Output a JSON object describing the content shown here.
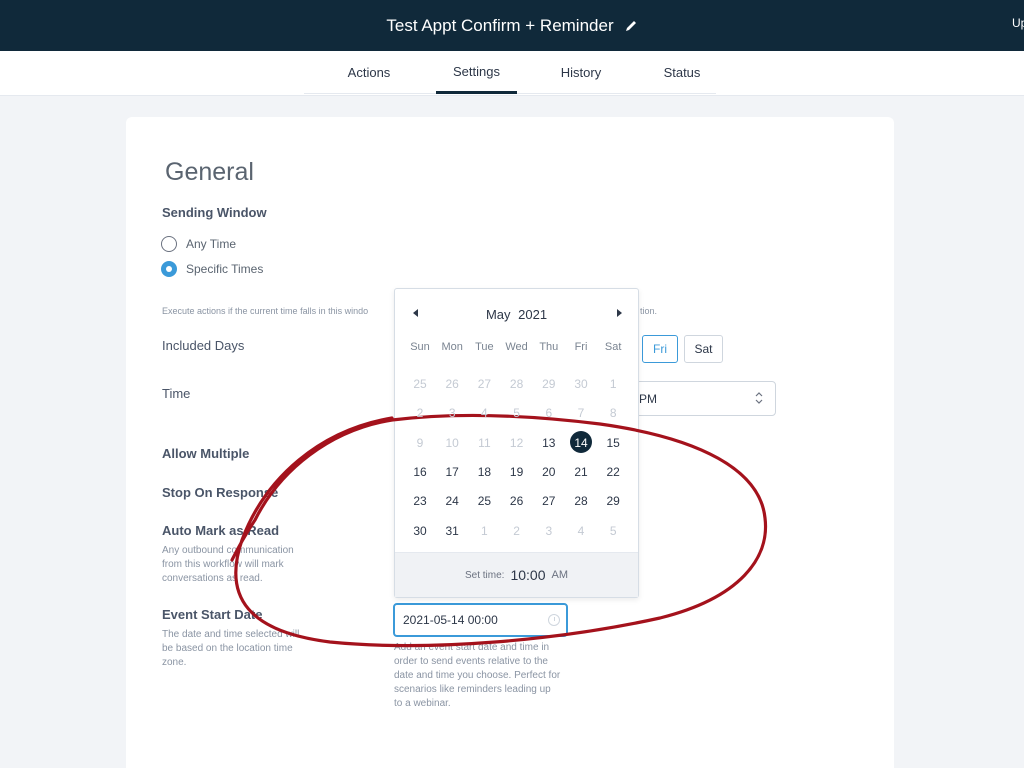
{
  "header": {
    "title": "Test Appt Confirm + Reminder",
    "right_text": "Up"
  },
  "tabs": [
    {
      "label": "Actions",
      "active": false
    },
    {
      "label": "Settings",
      "active": true
    },
    {
      "label": "History",
      "active": false
    },
    {
      "label": "Status",
      "active": false
    }
  ],
  "general": {
    "heading": "General",
    "sending_window": {
      "label": "Sending Window",
      "options": [
        {
          "label": "Any Time",
          "checked": false
        },
        {
          "label": "Specific Times",
          "checked": true
        }
      ],
      "helper_left": "Execute actions if the current time falls in this windo",
      "helper_right": "tion."
    },
    "included_days": {
      "label": "Included Days",
      "visible_days": [
        {
          "label": "Fri",
          "selected": true
        },
        {
          "label": "Sat",
          "selected": false
        }
      ]
    },
    "time": {
      "label": "Time",
      "end_value": "PM"
    },
    "allow_multiple": {
      "label": "Allow Multiple"
    },
    "stop_on_response": {
      "label": "Stop On Response"
    },
    "auto_mark_read": {
      "label": "Auto Mark as Read",
      "helper": [
        "Any outbound communication",
        "from this workflow will mark",
        "conversations as read."
      ]
    },
    "event_start_date": {
      "label": "Event Start Date",
      "helper": [
        "The date and time selected will",
        "be based on the location time",
        "zone."
      ],
      "value": "2021-05-14 00:00",
      "input_helper": [
        "Add an event start date and time in",
        "order to send events relative to the",
        "date and time you choose. Perfect for",
        "scenarios like reminders leading up",
        "to a webinar."
      ]
    }
  },
  "calendar": {
    "month": "May",
    "year": "2021",
    "weekdays": [
      "Sun",
      "Mon",
      "Tue",
      "Wed",
      "Thu",
      "Fri",
      "Sat"
    ],
    "weeks": [
      [
        {
          "d": "25",
          "m": true
        },
        {
          "d": "26",
          "m": true
        },
        {
          "d": "27",
          "m": true
        },
        {
          "d": "28",
          "m": true
        },
        {
          "d": "29",
          "m": true
        },
        {
          "d": "30",
          "m": true
        },
        {
          "d": "1",
          "m": true
        }
      ],
      [
        {
          "d": "2",
          "m": true
        },
        {
          "d": "3",
          "m": true
        },
        {
          "d": "4",
          "m": true
        },
        {
          "d": "5",
          "m": true
        },
        {
          "d": "6",
          "m": true
        },
        {
          "d": "7",
          "m": true
        },
        {
          "d": "8",
          "m": true
        }
      ],
      [
        {
          "d": "9",
          "m": true
        },
        {
          "d": "10",
          "m": true
        },
        {
          "d": "11",
          "m": true
        },
        {
          "d": "12",
          "m": true
        },
        {
          "d": "13",
          "m": false
        },
        {
          "d": "14",
          "m": false,
          "selected": true
        },
        {
          "d": "15",
          "m": false
        }
      ],
      [
        {
          "d": "16",
          "m": false
        },
        {
          "d": "17",
          "m": false
        },
        {
          "d": "18",
          "m": false
        },
        {
          "d": "19",
          "m": false
        },
        {
          "d": "20",
          "m": false
        },
        {
          "d": "21",
          "m": false
        },
        {
          "d": "22",
          "m": false
        }
      ],
      [
        {
          "d": "23",
          "m": false
        },
        {
          "d": "24",
          "m": false
        },
        {
          "d": "25",
          "m": false
        },
        {
          "d": "26",
          "m": false
        },
        {
          "d": "27",
          "m": false
        },
        {
          "d": "28",
          "m": false
        },
        {
          "d": "29",
          "m": false
        }
      ],
      [
        {
          "d": "30",
          "m": false
        },
        {
          "d": "31",
          "m": false
        },
        {
          "d": "1",
          "m": true
        },
        {
          "d": "2",
          "m": true
        },
        {
          "d": "3",
          "m": true
        },
        {
          "d": "4",
          "m": true
        },
        {
          "d": "5",
          "m": true
        }
      ]
    ],
    "set_time_label": "Set time:",
    "hour": "10",
    "minute": "00",
    "ampm": "AM"
  },
  "colors": {
    "header_bg": "#10293a",
    "accent": "#3b9ad9",
    "annotation": "#a4121c"
  }
}
